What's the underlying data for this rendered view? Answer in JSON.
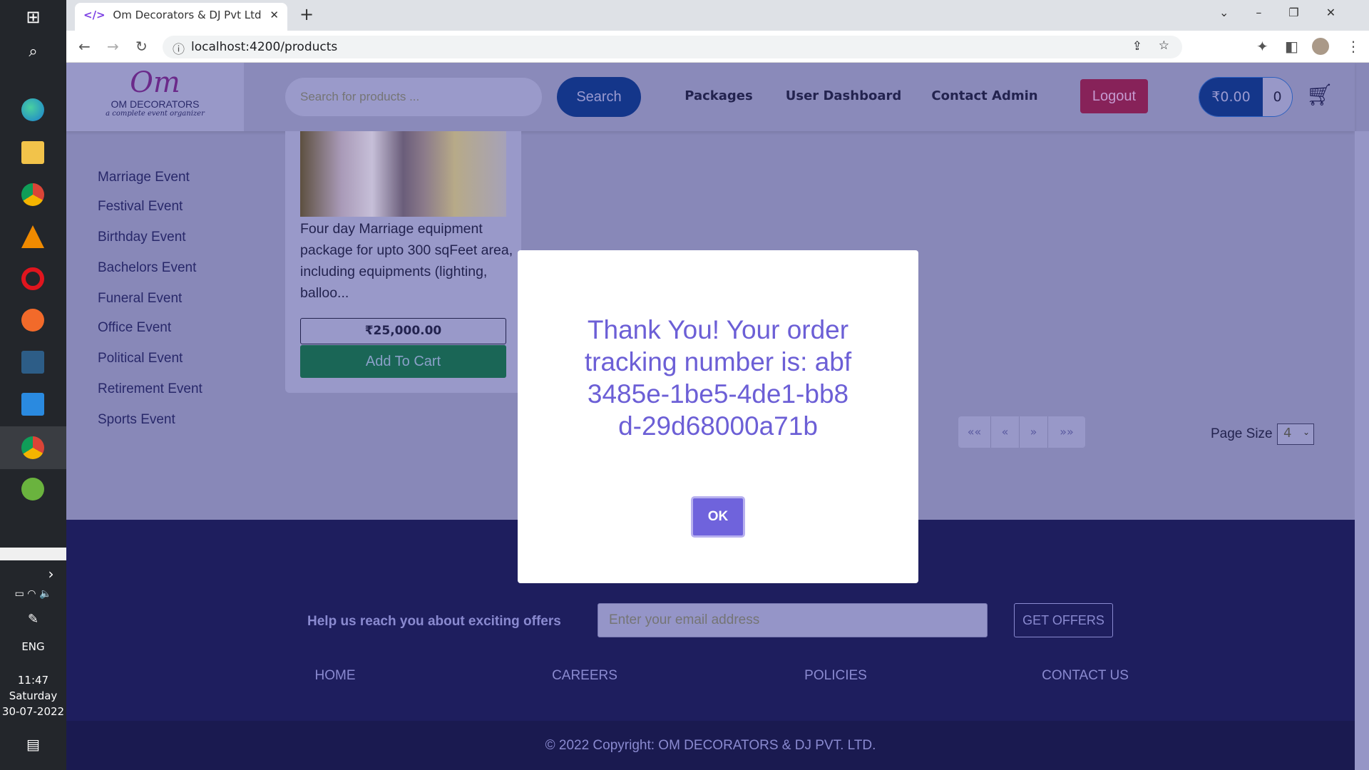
{
  "taskbar": {
    "lang": "ENG",
    "time": "11:47",
    "day": "Saturday",
    "date": "30-07-2022"
  },
  "browser": {
    "tab_title": "Om Decorators & DJ Pvt Ltd",
    "url": "localhost:4200/products",
    "new_tab": "+"
  },
  "header": {
    "logo_text": "OM DECORATORS",
    "logo_tagline": "a complete event organizer",
    "search_placeholder": "Search for products ...",
    "search_label": "Search",
    "nav": [
      "Packages",
      "User Dashboard",
      "Contact Admin"
    ],
    "logout": "Logout",
    "cart_total": "₹0.00",
    "cart_count": "0"
  },
  "sidebar": {
    "items": [
      "Marriage Event",
      "Festival Event",
      "Birthday Event",
      "Bachelors Event",
      "Funeral Event",
      "Office Event",
      "Political Event",
      "Retirement Event",
      "Sports Event"
    ]
  },
  "product": {
    "description": "Four day Marriage equipment package for upto 300 sqFeet area, including equipments (lighting, balloo...",
    "price": "₹25,000.00",
    "add_to_cart": "Add To Cart"
  },
  "pagination": {
    "first": "««",
    "prev": "«",
    "next": "»",
    "last": "»»",
    "page_size_label": "Page Size",
    "page_size": "4"
  },
  "footer": {
    "newsletter_text": "Help us reach you about exciting offers",
    "email_placeholder": "Enter your email address",
    "get_offers": "GET OFFERS",
    "links": [
      "HOME",
      "CAREERS",
      "POLICIES",
      "CONTACT US"
    ],
    "copyright": "© 2022 Copyright: OM DECORATORS & DJ PVT. LTD."
  },
  "modal": {
    "message": "Thank You! Your order tracking number is: abf3485e-1be5-4de1-bb8d-29d68000a71b",
    "ok": "OK"
  }
}
